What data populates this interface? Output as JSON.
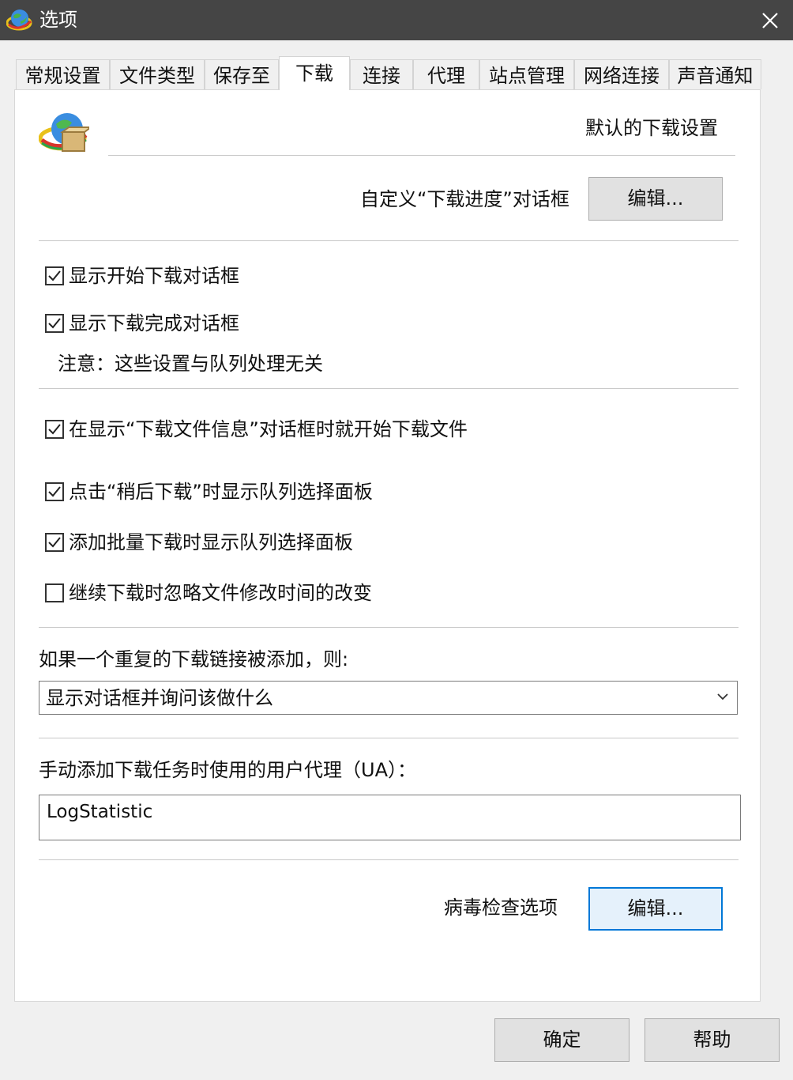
{
  "window": {
    "title": "选项",
    "app_icon": "idm-globe-icon",
    "close_icon": "close-icon"
  },
  "tabs": [
    {
      "label": "常规设置",
      "active": false
    },
    {
      "label": "文件类型",
      "active": false
    },
    {
      "label": "保存至",
      "active": false
    },
    {
      "label": "下载",
      "active": true
    },
    {
      "label": "连接",
      "active": false
    },
    {
      "label": "代理",
      "active": false
    },
    {
      "label": "站点管理",
      "active": false
    },
    {
      "label": "网络连接",
      "active": false
    },
    {
      "label": "声音通知",
      "active": false
    }
  ],
  "header": {
    "icon": "idm-globe-box-icon",
    "title": "默认的下载设置"
  },
  "progress_dialog": {
    "label": "自定义“下载进度”对话框",
    "button_label": "编辑..."
  },
  "checkboxes_group1": [
    {
      "label": "显示开始下载对话框",
      "checked": true
    },
    {
      "label": "显示下载完成对话框",
      "checked": true
    }
  ],
  "note": "注意：这些设置与队列处理无关",
  "checkboxes_group2": [
    {
      "label": "在显示“下载文件信息”对话框时就开始下载文件",
      "checked": true
    },
    {
      "label": "点击“稍后下载”时显示队列选择面板",
      "checked": true
    },
    {
      "label": "添加批量下载时显示队列选择面板",
      "checked": true
    },
    {
      "label": "继续下载时忽略文件修改时间的改变",
      "checked": false
    }
  ],
  "duplicate": {
    "label": "如果一个重复的下载链接被添加，则:",
    "selected": "显示对话框并询问该做什么"
  },
  "user_agent": {
    "label": "手动添加下载任务时使用的用户代理（UA）：",
    "value": "LogStatistic"
  },
  "virus": {
    "label": "病毒检查选项",
    "button_label": "编辑..."
  },
  "footer": {
    "ok_label": "确定",
    "help_label": "帮助"
  },
  "colors": {
    "titlebar": "#454545",
    "focus_border": "#0078d7",
    "panel_bg": "#ffffff",
    "window_bg": "#f0f0f0"
  }
}
